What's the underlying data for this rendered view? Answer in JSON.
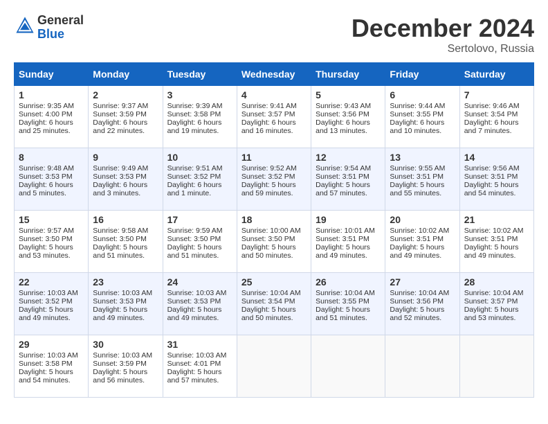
{
  "header": {
    "logo_line1": "General",
    "logo_line2": "Blue",
    "month": "December 2024",
    "location": "Sertolovo, Russia"
  },
  "days_of_week": [
    "Sunday",
    "Monday",
    "Tuesday",
    "Wednesday",
    "Thursday",
    "Friday",
    "Saturday"
  ],
  "weeks": [
    [
      {
        "day": "1",
        "sunrise": "Sunrise: 9:35 AM",
        "sunset": "Sunset: 4:00 PM",
        "daylight": "Daylight: 6 hours and 25 minutes."
      },
      {
        "day": "2",
        "sunrise": "Sunrise: 9:37 AM",
        "sunset": "Sunset: 3:59 PM",
        "daylight": "Daylight: 6 hours and 22 minutes."
      },
      {
        "day": "3",
        "sunrise": "Sunrise: 9:39 AM",
        "sunset": "Sunset: 3:58 PM",
        "daylight": "Daylight: 6 hours and 19 minutes."
      },
      {
        "day": "4",
        "sunrise": "Sunrise: 9:41 AM",
        "sunset": "Sunset: 3:57 PM",
        "daylight": "Daylight: 6 hours and 16 minutes."
      },
      {
        "day": "5",
        "sunrise": "Sunrise: 9:43 AM",
        "sunset": "Sunset: 3:56 PM",
        "daylight": "Daylight: 6 hours and 13 minutes."
      },
      {
        "day": "6",
        "sunrise": "Sunrise: 9:44 AM",
        "sunset": "Sunset: 3:55 PM",
        "daylight": "Daylight: 6 hours and 10 minutes."
      },
      {
        "day": "7",
        "sunrise": "Sunrise: 9:46 AM",
        "sunset": "Sunset: 3:54 PM",
        "daylight": "Daylight: 6 hours and 7 minutes."
      }
    ],
    [
      {
        "day": "8",
        "sunrise": "Sunrise: 9:48 AM",
        "sunset": "Sunset: 3:53 PM",
        "daylight": "Daylight: 6 hours and 5 minutes."
      },
      {
        "day": "9",
        "sunrise": "Sunrise: 9:49 AM",
        "sunset": "Sunset: 3:53 PM",
        "daylight": "Daylight: 6 hours and 3 minutes."
      },
      {
        "day": "10",
        "sunrise": "Sunrise: 9:51 AM",
        "sunset": "Sunset: 3:52 PM",
        "daylight": "Daylight: 6 hours and 1 minute."
      },
      {
        "day": "11",
        "sunrise": "Sunrise: 9:52 AM",
        "sunset": "Sunset: 3:52 PM",
        "daylight": "Daylight: 5 hours and 59 minutes."
      },
      {
        "day": "12",
        "sunrise": "Sunrise: 9:54 AM",
        "sunset": "Sunset: 3:51 PM",
        "daylight": "Daylight: 5 hours and 57 minutes."
      },
      {
        "day": "13",
        "sunrise": "Sunrise: 9:55 AM",
        "sunset": "Sunset: 3:51 PM",
        "daylight": "Daylight: 5 hours and 55 minutes."
      },
      {
        "day": "14",
        "sunrise": "Sunrise: 9:56 AM",
        "sunset": "Sunset: 3:51 PM",
        "daylight": "Daylight: 5 hours and 54 minutes."
      }
    ],
    [
      {
        "day": "15",
        "sunrise": "Sunrise: 9:57 AM",
        "sunset": "Sunset: 3:50 PM",
        "daylight": "Daylight: 5 hours and 53 minutes."
      },
      {
        "day": "16",
        "sunrise": "Sunrise: 9:58 AM",
        "sunset": "Sunset: 3:50 PM",
        "daylight": "Daylight: 5 hours and 51 minutes."
      },
      {
        "day": "17",
        "sunrise": "Sunrise: 9:59 AM",
        "sunset": "Sunset: 3:50 PM",
        "daylight": "Daylight: 5 hours and 51 minutes."
      },
      {
        "day": "18",
        "sunrise": "Sunrise: 10:00 AM",
        "sunset": "Sunset: 3:50 PM",
        "daylight": "Daylight: 5 hours and 50 minutes."
      },
      {
        "day": "19",
        "sunrise": "Sunrise: 10:01 AM",
        "sunset": "Sunset: 3:51 PM",
        "daylight": "Daylight: 5 hours and 49 minutes."
      },
      {
        "day": "20",
        "sunrise": "Sunrise: 10:02 AM",
        "sunset": "Sunset: 3:51 PM",
        "daylight": "Daylight: 5 hours and 49 minutes."
      },
      {
        "day": "21",
        "sunrise": "Sunrise: 10:02 AM",
        "sunset": "Sunset: 3:51 PM",
        "daylight": "Daylight: 5 hours and 49 minutes."
      }
    ],
    [
      {
        "day": "22",
        "sunrise": "Sunrise: 10:03 AM",
        "sunset": "Sunset: 3:52 PM",
        "daylight": "Daylight: 5 hours and 49 minutes."
      },
      {
        "day": "23",
        "sunrise": "Sunrise: 10:03 AM",
        "sunset": "Sunset: 3:53 PM",
        "daylight": "Daylight: 5 hours and 49 minutes."
      },
      {
        "day": "24",
        "sunrise": "Sunrise: 10:03 AM",
        "sunset": "Sunset: 3:53 PM",
        "daylight": "Daylight: 5 hours and 49 minutes."
      },
      {
        "day": "25",
        "sunrise": "Sunrise: 10:04 AM",
        "sunset": "Sunset: 3:54 PM",
        "daylight": "Daylight: 5 hours and 50 minutes."
      },
      {
        "day": "26",
        "sunrise": "Sunrise: 10:04 AM",
        "sunset": "Sunset: 3:55 PM",
        "daylight": "Daylight: 5 hours and 51 minutes."
      },
      {
        "day": "27",
        "sunrise": "Sunrise: 10:04 AM",
        "sunset": "Sunset: 3:56 PM",
        "daylight": "Daylight: 5 hours and 52 minutes."
      },
      {
        "day": "28",
        "sunrise": "Sunrise: 10:04 AM",
        "sunset": "Sunset: 3:57 PM",
        "daylight": "Daylight: 5 hours and 53 minutes."
      }
    ],
    [
      {
        "day": "29",
        "sunrise": "Sunrise: 10:03 AM",
        "sunset": "Sunset: 3:58 PM",
        "daylight": "Daylight: 5 hours and 54 minutes."
      },
      {
        "day": "30",
        "sunrise": "Sunrise: 10:03 AM",
        "sunset": "Sunset: 3:59 PM",
        "daylight": "Daylight: 5 hours and 56 minutes."
      },
      {
        "day": "31",
        "sunrise": "Sunrise: 10:03 AM",
        "sunset": "Sunset: 4:01 PM",
        "daylight": "Daylight: 5 hours and 57 minutes."
      },
      null,
      null,
      null,
      null
    ]
  ]
}
